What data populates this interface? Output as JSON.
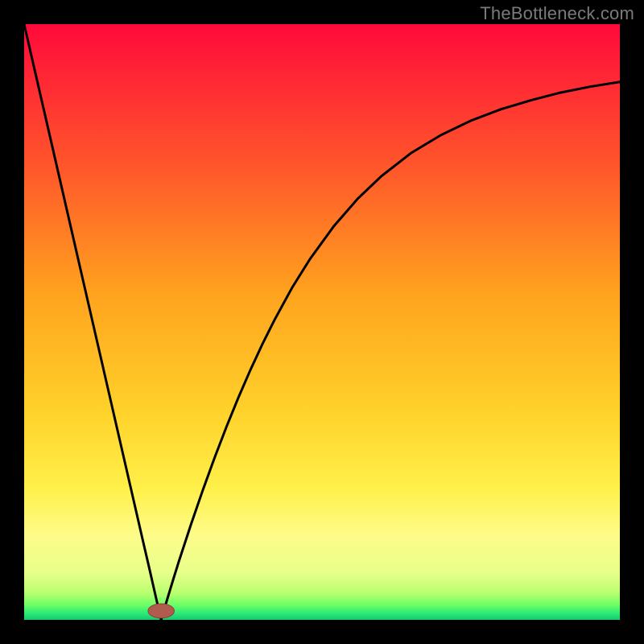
{
  "watermark": "TheBottleneck.com",
  "colors": {
    "gradient_stops": [
      {
        "offset": 0.0,
        "color": "#ff0a3a"
      },
      {
        "offset": 0.1,
        "color": "#ff2a34"
      },
      {
        "offset": 0.25,
        "color": "#ff5a2a"
      },
      {
        "offset": 0.45,
        "color": "#ffa21e"
      },
      {
        "offset": 0.65,
        "color": "#ffd22a"
      },
      {
        "offset": 0.78,
        "color": "#fff04a"
      },
      {
        "offset": 0.86,
        "color": "#fefc8a"
      },
      {
        "offset": 0.92,
        "color": "#e8ff8a"
      },
      {
        "offset": 0.955,
        "color": "#b8ff70"
      },
      {
        "offset": 0.975,
        "color": "#6cff66"
      },
      {
        "offset": 0.99,
        "color": "#28e878"
      },
      {
        "offset": 1.0,
        "color": "#14c96a"
      }
    ],
    "curve": "#000000",
    "marker_fill": "#b15a4e",
    "marker_stroke": "#8f4038"
  },
  "chart_data": {
    "type": "line",
    "title": "",
    "xlabel": "",
    "ylabel": "",
    "xlim": [
      0,
      100
    ],
    "ylim": [
      0,
      100
    ],
    "grid": false,
    "legend": false,
    "marker": {
      "x": 23,
      "y": 1.5,
      "rx": 2.2,
      "ry": 1.2
    },
    "series": [
      {
        "name": "left-branch",
        "x": [
          0,
          2,
          4,
          6,
          8,
          10,
          12,
          14,
          16,
          18,
          20,
          21,
          22,
          22.6,
          23
        ],
        "y": [
          100,
          91.3,
          82.6,
          73.9,
          65.2,
          56.5,
          47.8,
          39.1,
          30.4,
          21.7,
          13.0,
          8.7,
          4.3,
          1.7,
          0
        ]
      },
      {
        "name": "right-branch",
        "x": [
          23,
          24,
          25,
          26,
          28,
          30,
          32,
          34,
          36,
          38,
          40,
          42,
          45,
          48,
          52,
          56,
          60,
          65,
          70,
          75,
          80,
          85,
          90,
          95,
          100
        ],
        "y": [
          0,
          3.4,
          6.7,
          9.9,
          16.0,
          21.8,
          27.3,
          32.5,
          37.4,
          42.0,
          46.3,
          50.3,
          55.8,
          60.6,
          66.1,
          70.7,
          74.5,
          78.4,
          81.4,
          83.8,
          85.7,
          87.2,
          88.5,
          89.5,
          90.3
        ]
      }
    ]
  }
}
